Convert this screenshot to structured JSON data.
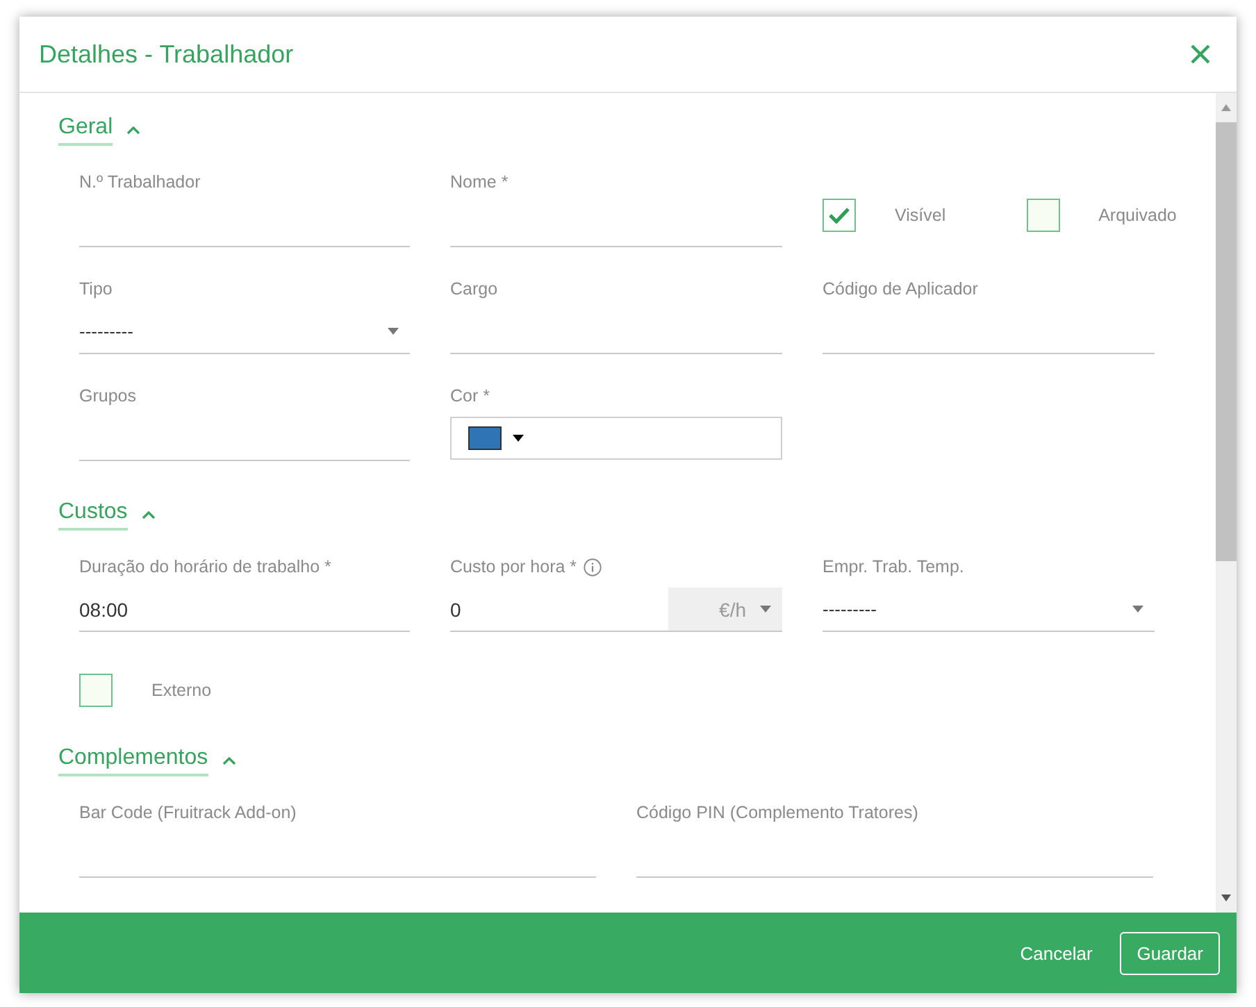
{
  "dialog": {
    "title": "Detalhes - Trabalhador"
  },
  "sections": [
    {
      "title": "Geral",
      "expanded": true,
      "fields": [
        {
          "kind": "text",
          "label": "N.º Trabalhador"
        },
        {
          "kind": "text",
          "label": "Nome *"
        },
        {
          "kind": "checkboxes",
          "items": [
            {
              "label": "Visível",
              "checked": true
            },
            {
              "label": "Arquivado",
              "checked": false
            }
          ]
        },
        {
          "kind": "select",
          "label": "Tipo",
          "value": "---------"
        },
        {
          "kind": "text",
          "label": "Cargo"
        },
        {
          "kind": "text",
          "label": "Código de Aplicador"
        },
        {
          "kind": "text",
          "label": "Grupos"
        },
        {
          "kind": "color",
          "label": "Cor *",
          "color": "#2f75b5"
        }
      ]
    },
    {
      "title": "Custos",
      "expanded": true,
      "fields": [
        {
          "kind": "text",
          "label": "Duração do horário de trabalho *",
          "value": "08:00"
        },
        {
          "kind": "currency",
          "label": "Custo por hora *",
          "value": "0",
          "unit": "€/h"
        },
        {
          "kind": "select",
          "label": "Empr. Trab. Temp.",
          "value": "---------"
        },
        {
          "kind": "checkboxes",
          "items": [
            {
              "label": "Externo",
              "checked": false
            }
          ]
        }
      ]
    },
    {
      "title": "Complementos",
      "expanded": true,
      "fields": [
        {
          "kind": "text",
          "label": "Bar Code (Fruitrack Add-on)"
        },
        {
          "kind": "text",
          "label": "Código PIN (Complemento Tratores)"
        }
      ]
    }
  ],
  "footer": {
    "buttons": [
      {
        "label": "Cancelar",
        "kind": "link"
      },
      {
        "label": "Guardar",
        "kind": "outlined"
      }
    ]
  }
}
